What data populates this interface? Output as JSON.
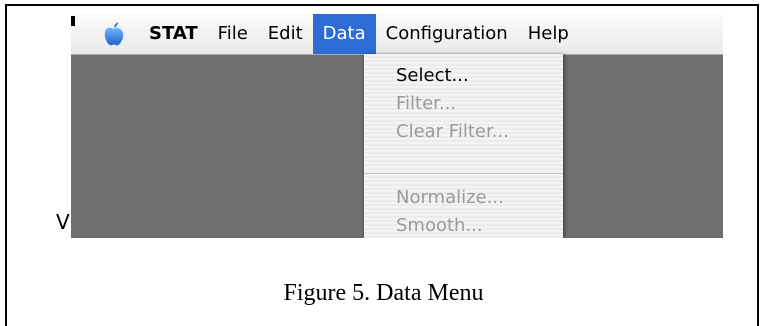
{
  "menubar": {
    "app_name": "STAT",
    "menus": [
      "File",
      "Edit",
      "Data",
      "Configuration",
      "Help"
    ],
    "active_menu": "Data",
    "highlight_color": "#2f6bd4"
  },
  "dropdown": {
    "items": [
      {
        "label": "Select...",
        "enabled": true
      },
      {
        "label": "Filter...",
        "enabled": false
      },
      {
        "label": "Clear Filter...",
        "enabled": false
      },
      {
        "label": "Normalize...",
        "enabled": false
      },
      {
        "label": "Smooth...",
        "enabled": false
      }
    ]
  },
  "stray_mark": "V",
  "caption": "Figure 5.  Data Menu",
  "icons": {
    "apple": "apple-logo-icon"
  }
}
